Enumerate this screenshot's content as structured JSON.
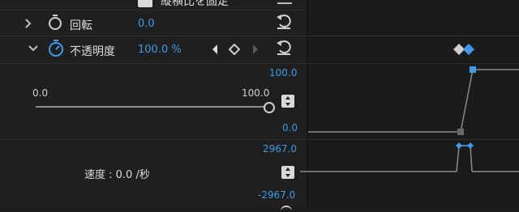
{
  "top_partial": {
    "label": "縦横比を固定"
  },
  "rotation": {
    "label": "回転",
    "value": "0.0"
  },
  "opacity": {
    "label": "不透明度",
    "value": "100.0 %",
    "slider_min": "0.0",
    "slider_max": "100.0",
    "graph_top": "100.0",
    "graph_bottom": "0.0"
  },
  "velocity": {
    "label": "速度 : 0.0 /秒",
    "top": "2967.0",
    "bottom": "-2967.0"
  },
  "colors": {
    "accent_blue": "#3f9ae8",
    "panel_bg": "#1f1f1f"
  }
}
